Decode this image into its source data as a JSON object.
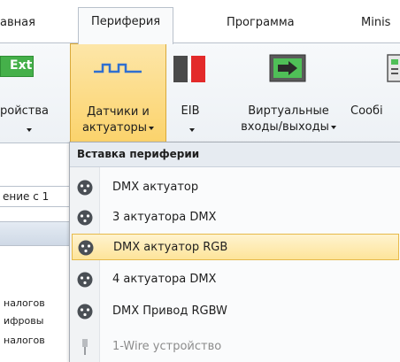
{
  "tabs": [
    {
      "label": "авная"
    },
    {
      "label": "Периферия"
    },
    {
      "label": "Программа"
    },
    {
      "label": "Minis"
    }
  ],
  "ribbon": {
    "left_label": "ройства",
    "left_badge": "Ext",
    "sensors_line1": "Датчики и",
    "sensors_line2": "актуаторы",
    "eib_label": "EIB",
    "virtual_line1": "Виртуальные",
    "virtual_line2": "входы/выходы",
    "messages_label": "Сообі"
  },
  "background": {
    "field_text": "ение с 1",
    "lines": [
      "налогов",
      "ифровы",
      "налогов"
    ]
  },
  "menu": {
    "header": "Вставка периферии",
    "items": [
      {
        "label": "DMX актуатор"
      },
      {
        "label": "3 актуатора DMX"
      },
      {
        "label": "DMX актуатор RGB"
      },
      {
        "label": "4 актуатора DMX"
      },
      {
        "label": "DMX Привод RGBW"
      },
      {
        "label": "1-Wire устройство"
      }
    ]
  },
  "colors": {
    "highlight": "#fde49a",
    "highlight_border": "#e6b94a",
    "pressed": "#fbd36c",
    "ribbon_border": "#b9c1cc",
    "ext_green": "#45b04a",
    "eib_red": "#e32a2a",
    "eib_gray": "#4a4a4a"
  }
}
